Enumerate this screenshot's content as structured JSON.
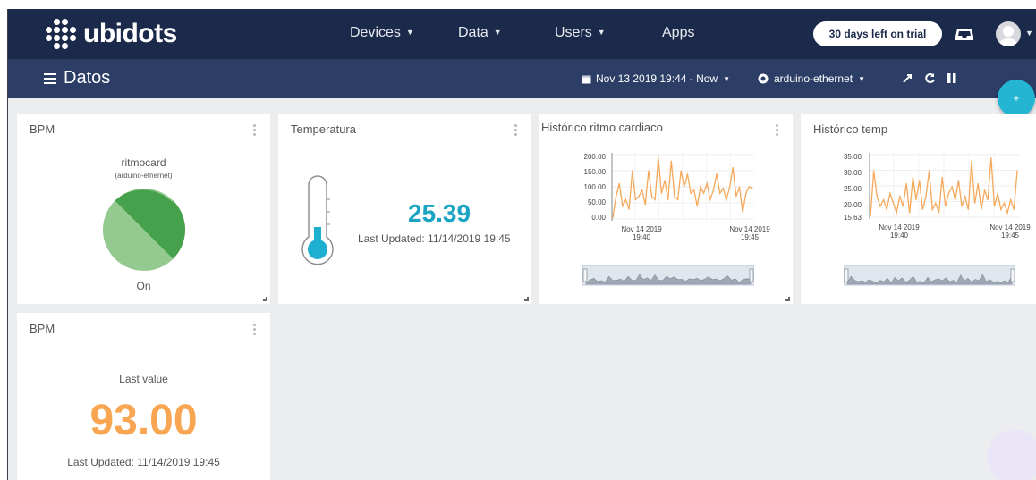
{
  "brand": {
    "name": "ubidots"
  },
  "nav": {
    "items": [
      {
        "label": "Devices",
        "has_caret": true
      },
      {
        "label": "Data",
        "has_caret": true
      },
      {
        "label": "Users",
        "has_caret": true
      },
      {
        "label": "Apps",
        "has_caret": false
      }
    ],
    "trial_label": "30 days left on trial"
  },
  "toolbar": {
    "page_title": "Datos",
    "date_range": "Nov 13 2019 19:44 - Now",
    "device": "arduino-ethernet"
  },
  "fab": {
    "label": "+"
  },
  "widgets": {
    "bpm_indicator": {
      "title": "BPM",
      "variable": "ritmocard",
      "device": "(arduino-ethernet)",
      "state": "On",
      "colors": {
        "dark": "#45a14b",
        "light": "#94c98f"
      }
    },
    "temperature": {
      "title": "Temperatura",
      "value": "25.39",
      "updated": "Last Updated: 11/14/2019 19:45",
      "fill_fraction": 0.35,
      "color": "#1fb0d1"
    },
    "hr_history": {
      "title": "Histórico ritmo cardiaco",
      "ymin_label": "0.00",
      "x_labels": [
        "Nov 14 2019\n19:40",
        "Nov 14 2019\n19:45"
      ],
      "y_ticks": [
        "200.00",
        "150.00",
        "100.00",
        "50.00",
        "0.00"
      ]
    },
    "temp_history": {
      "title": "Histórico temp",
      "x_labels": [
        "Nov 14 2019\n19:40",
        "Nov 14 2019\n19:45"
      ],
      "y_ticks": [
        "35.00",
        "30.00",
        "25.00",
        "20.00",
        "15.63"
      ]
    },
    "bpm_value": {
      "title": "BPM",
      "caption": "Last value",
      "value": "93.00",
      "updated": "Last Updated: 11/14/2019 19:45"
    }
  },
  "chart_data": [
    {
      "type": "line",
      "title": "",
      "xlabel": "",
      "ylabel": "",
      "ylim": [
        0,
        200
      ],
      "x_tick_labels": [
        "Nov 14 2019 19:40",
        "Nov 14 2019 19:45"
      ],
      "color": "#f5a85a",
      "values": [
        5,
        70,
        110,
        40,
        60,
        30,
        150,
        60,
        70,
        90,
        45,
        150,
        70,
        60,
        190,
        80,
        120,
        60,
        180,
        70,
        60,
        150,
        100,
        140,
        80,
        90,
        40,
        100,
        80,
        110,
        60,
        90,
        140,
        80,
        95,
        60,
        100,
        160,
        70,
        100,
        20,
        80,
        100,
        95
      ]
    },
    {
      "type": "line",
      "title": "",
      "xlabel": "",
      "ylabel": "",
      "ylim": [
        15.63,
        35
      ],
      "x_tick_labels": [
        "Nov 14 2019 19:40",
        "Nov 14 2019 19:45"
      ],
      "color": "#f5a85a",
      "values": [
        16,
        30,
        22,
        19,
        21,
        18,
        23,
        20,
        17,
        22,
        19,
        26,
        17,
        28,
        21,
        27,
        18,
        22,
        30,
        18,
        20,
        17,
        28,
        19,
        23,
        25,
        21,
        27,
        19,
        22,
        18,
        33,
        20,
        26,
        18,
        24,
        21,
        34,
        19,
        23,
        18,
        20,
        17,
        21,
        18,
        30
      ]
    }
  ]
}
